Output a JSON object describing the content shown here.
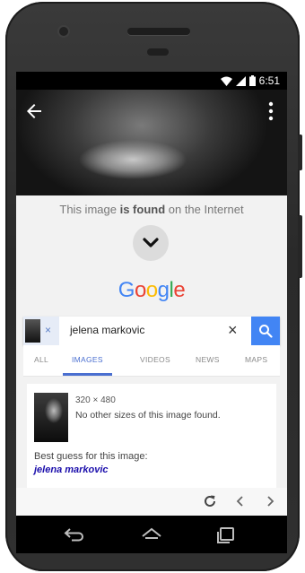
{
  "status": {
    "time": "6:51"
  },
  "sheet": {
    "found_prefix": "This image ",
    "found_bold": "is found",
    "found_suffix": " on the Internet"
  },
  "google": {
    "logo_letters": [
      "G",
      "o",
      "o",
      "g",
      "l",
      "e"
    ]
  },
  "search": {
    "query": "jelena markovic",
    "clear_label": "×",
    "chip_close": "×"
  },
  "tabs": [
    {
      "label": "ALL",
      "active": false
    },
    {
      "label": "IMAGES",
      "active": true
    },
    {
      "label": "VIDEOS",
      "active": false
    },
    {
      "label": "NEWS",
      "active": false
    },
    {
      "label": "MAPS",
      "active": false
    }
  ],
  "result": {
    "dimensions": "320 × 480",
    "no_sizes": "No other sizes of this image found.",
    "best_guess_label": "Best guess for this image:",
    "best_guess_value": "jelena markovic"
  },
  "colors": {
    "google_blue": "#4285F4",
    "link": "#1a0dab",
    "tab_active": "#4a6fd0"
  },
  "icons": [
    "back-arrow-icon",
    "more-vert-icon",
    "chevron-down-icon",
    "search-icon",
    "refresh-icon",
    "chevron-left-icon",
    "chevron-right-icon",
    "nav-back-icon",
    "nav-home-icon",
    "nav-recents-icon",
    "wifi-icon",
    "signal-icon",
    "battery-icon"
  ]
}
